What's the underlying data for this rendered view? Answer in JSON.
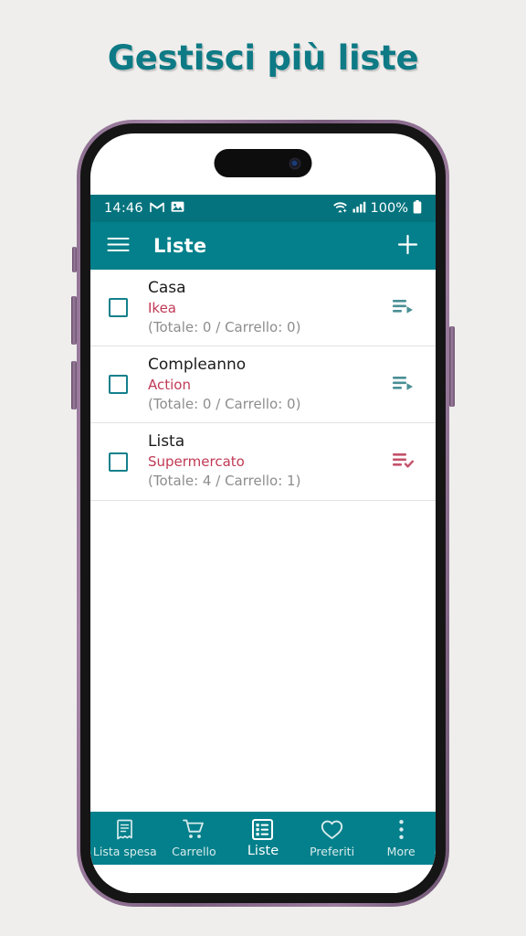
{
  "headline": "Gestisci più liste",
  "theme": {
    "teal": "#03808b",
    "teal_dark": "#04737e",
    "headline_teal": "#0e7a85",
    "crimson": "#c03a55",
    "page_bg": "#efeeec"
  },
  "statusbar": {
    "time": "14:46",
    "battery_percent": "100%",
    "icons": [
      "gmail-icon",
      "photo-icon",
      "wifi-icon",
      "cellular-signal-icon",
      "battery-icon"
    ]
  },
  "appbar": {
    "menu_icon": "hamburger-menu-icon",
    "title": "Liste",
    "add_icon": "plus-icon"
  },
  "lists": [
    {
      "title": "Casa",
      "store": "Ikea",
      "counts": "(Totale: 0 / Carrello: 0)",
      "action_icon": "playlist-play-icon",
      "action_color": "#4a8f96",
      "checked": false
    },
    {
      "title": "Compleanno",
      "store": "Action",
      "counts": "(Totale: 0 / Carrello: 0)",
      "action_icon": "playlist-play-icon",
      "action_color": "#4a8f96",
      "checked": false
    },
    {
      "title": "Lista",
      "store": "Supermercato",
      "counts": "(Totale: 4 / Carrello: 1)",
      "action_icon": "playlist-check-icon",
      "action_color": "#c4526a",
      "checked": false
    }
  ],
  "bottomnav": {
    "items": [
      {
        "label": "Lista spesa",
        "icon": "receipt-icon",
        "active": false
      },
      {
        "label": "Carrello",
        "icon": "shopping-cart-icon",
        "active": false
      },
      {
        "label": "Liste",
        "icon": "list-view-icon",
        "active": true
      },
      {
        "label": "Preferiti",
        "icon": "heart-icon",
        "active": false
      },
      {
        "label": "More",
        "icon": "more-vertical-icon",
        "active": false
      }
    ]
  }
}
